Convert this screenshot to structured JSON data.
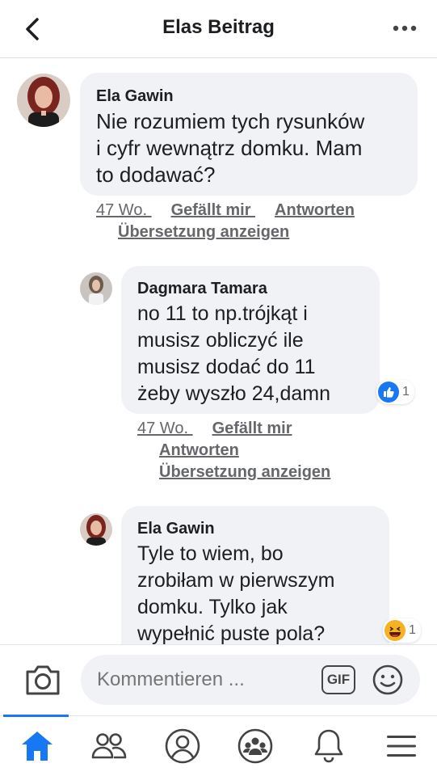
{
  "header": {
    "title": "Elas Beitrag"
  },
  "comments": [
    {
      "author": "Ela Gawin",
      "text": "Nie rozumiem tych rysunków\ni cyfr wewnątrz domku. Mam\nto dodawać?",
      "time": "47 Wo.",
      "like_label": "Gefällt mir",
      "reply_label": "Antworten",
      "translate_label": "Übersetzung anzeigen"
    },
    {
      "author": "Dagmara Tamara",
      "text": "no 11 to np.trójkąt i\nmusisz obliczyć ile\nmusisz dodać do 11\nżeby wyszło 24,damn",
      "time": "47 Wo.",
      "like_label": "Gefällt mir",
      "reply_label": "Antworten",
      "translate_label": "Übersetzung anzeigen",
      "reaction": {
        "icon": "like-icon",
        "count": "1",
        "color": "#1877f2"
      }
    },
    {
      "author": "Ela Gawin",
      "text": "Tyle to wiem, bo\nzrobiłam w pierwszym\ndomku. Tylko jak\nwypełnić puste pola?",
      "reaction": {
        "icon": "haha-icon",
        "count": "1",
        "color": "#f7b125"
      }
    }
  ],
  "composer": {
    "placeholder": "Kommentieren ...",
    "gif_label": "GIF"
  },
  "nav": {
    "items": [
      "home-icon",
      "friends-icon",
      "profile-icon",
      "groups-icon",
      "notifications-icon",
      "menu-icon"
    ],
    "active": "home-icon",
    "accent": "#1877f2"
  }
}
